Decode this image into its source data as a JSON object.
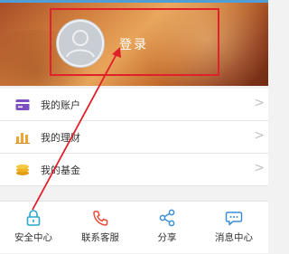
{
  "header": {
    "login_label": "登录"
  },
  "menu": {
    "items": [
      {
        "label": "我的账户",
        "icon": "account-card-icon",
        "color": "#7b4fbf"
      },
      {
        "label": "我的理财",
        "icon": "bar-chart-icon",
        "color": "#f0a531"
      },
      {
        "label": "我的基金",
        "icon": "coins-stack-icon",
        "color": "#f0b020"
      }
    ]
  },
  "tabbar": {
    "tabs": [
      {
        "label": "安全中心",
        "icon": "lock-icon",
        "color": "#2aa7c9"
      },
      {
        "label": "联系客服",
        "icon": "phone-icon",
        "color": "#e94a3a"
      },
      {
        "label": "分享",
        "icon": "share-icon",
        "color": "#3a8fd9"
      },
      {
        "label": "消息中心",
        "icon": "chat-bubble-icon",
        "color": "#3a8fd9"
      }
    ]
  },
  "annotation": {
    "highlight_color": "#e0202a"
  }
}
